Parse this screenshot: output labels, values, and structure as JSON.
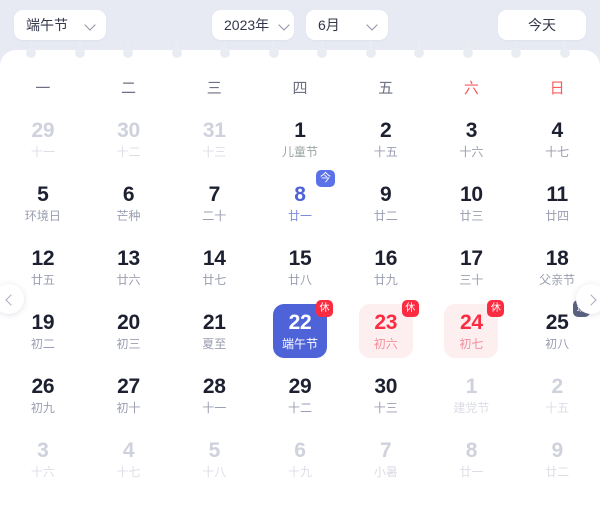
{
  "toolbar": {
    "festival_selected": "端午节",
    "year_selected": "2023年",
    "month_selected": "6月",
    "today_label": "今天"
  },
  "weekdays": [
    {
      "label": "一",
      "weekend": false
    },
    {
      "label": "二",
      "weekend": false
    },
    {
      "label": "三",
      "weekend": false
    },
    {
      "label": "四",
      "weekend": false
    },
    {
      "label": "五",
      "weekend": false
    },
    {
      "label": "六",
      "weekend": true
    },
    {
      "label": "日",
      "weekend": true
    }
  ],
  "nav": {
    "prev_icon": "chevron-left-icon",
    "next_icon": "chevron-right-icon"
  },
  "badges": {
    "rest": "休",
    "work": "班",
    "today": "今"
  },
  "weeks": [
    [
      {
        "solar": "29",
        "lunar": "十一",
        "state": "other"
      },
      {
        "solar": "30",
        "lunar": "十二",
        "state": "other"
      },
      {
        "solar": "31",
        "lunar": "十三",
        "state": "other"
      },
      {
        "solar": "1",
        "lunar": "儿童节",
        "state": "normal",
        "festival": true
      },
      {
        "solar": "2",
        "lunar": "十五",
        "state": "normal"
      },
      {
        "solar": "3",
        "lunar": "十六",
        "state": "normal"
      },
      {
        "solar": "4",
        "lunar": "十七",
        "state": "normal"
      }
    ],
    [
      {
        "solar": "5",
        "lunar": "环境日",
        "state": "normal"
      },
      {
        "solar": "6",
        "lunar": "芒种",
        "state": "normal"
      },
      {
        "solar": "7",
        "lunar": "二十",
        "state": "normal"
      },
      {
        "solar": "8",
        "lunar": "廿一",
        "state": "today",
        "badge": "today"
      },
      {
        "solar": "9",
        "lunar": "廿二",
        "state": "normal"
      },
      {
        "solar": "10",
        "lunar": "廿三",
        "state": "normal"
      },
      {
        "solar": "11",
        "lunar": "廿四",
        "state": "normal"
      }
    ],
    [
      {
        "solar": "12",
        "lunar": "廿五",
        "state": "normal"
      },
      {
        "solar": "13",
        "lunar": "廿六",
        "state": "normal"
      },
      {
        "solar": "14",
        "lunar": "廿七",
        "state": "normal"
      },
      {
        "solar": "15",
        "lunar": "廿八",
        "state": "normal"
      },
      {
        "solar": "16",
        "lunar": "廿九",
        "state": "normal"
      },
      {
        "solar": "17",
        "lunar": "三十",
        "state": "normal"
      },
      {
        "solar": "18",
        "lunar": "父亲节",
        "state": "normal"
      }
    ],
    [
      {
        "solar": "19",
        "lunar": "初二",
        "state": "normal"
      },
      {
        "solar": "20",
        "lunar": "初三",
        "state": "normal"
      },
      {
        "solar": "21",
        "lunar": "夏至",
        "state": "normal"
      },
      {
        "solar": "22",
        "lunar": "端午节",
        "state": "selected",
        "badge": "rest"
      },
      {
        "solar": "23",
        "lunar": "初六",
        "state": "rest",
        "badge": "rest"
      },
      {
        "solar": "24",
        "lunar": "初七",
        "state": "rest",
        "badge": "rest"
      },
      {
        "solar": "25",
        "lunar": "初八",
        "state": "normal",
        "badge": "work"
      }
    ],
    [
      {
        "solar": "26",
        "lunar": "初九",
        "state": "normal"
      },
      {
        "solar": "27",
        "lunar": "初十",
        "state": "normal"
      },
      {
        "solar": "28",
        "lunar": "十一",
        "state": "normal"
      },
      {
        "solar": "29",
        "lunar": "十二",
        "state": "normal"
      },
      {
        "solar": "30",
        "lunar": "十三",
        "state": "normal"
      },
      {
        "solar": "1",
        "lunar": "建党节",
        "state": "other",
        "festival": true
      },
      {
        "solar": "2",
        "lunar": "十五",
        "state": "other"
      }
    ],
    [
      {
        "solar": "3",
        "lunar": "十六",
        "state": "other"
      },
      {
        "solar": "4",
        "lunar": "十七",
        "state": "other"
      },
      {
        "solar": "5",
        "lunar": "十八",
        "state": "other"
      },
      {
        "solar": "6",
        "lunar": "十九",
        "state": "other"
      },
      {
        "solar": "7",
        "lunar": "小暑",
        "state": "other"
      },
      {
        "solar": "8",
        "lunar": "廿一",
        "state": "other"
      },
      {
        "solar": "9",
        "lunar": "廿二",
        "state": "other"
      }
    ]
  ],
  "colors": {
    "page_bg": "#e7eaf3",
    "accent": "#4f63d9",
    "rest_red": "#fb2c41",
    "rest_bg": "#fdeef0",
    "work_badge": "#5a6180"
  }
}
